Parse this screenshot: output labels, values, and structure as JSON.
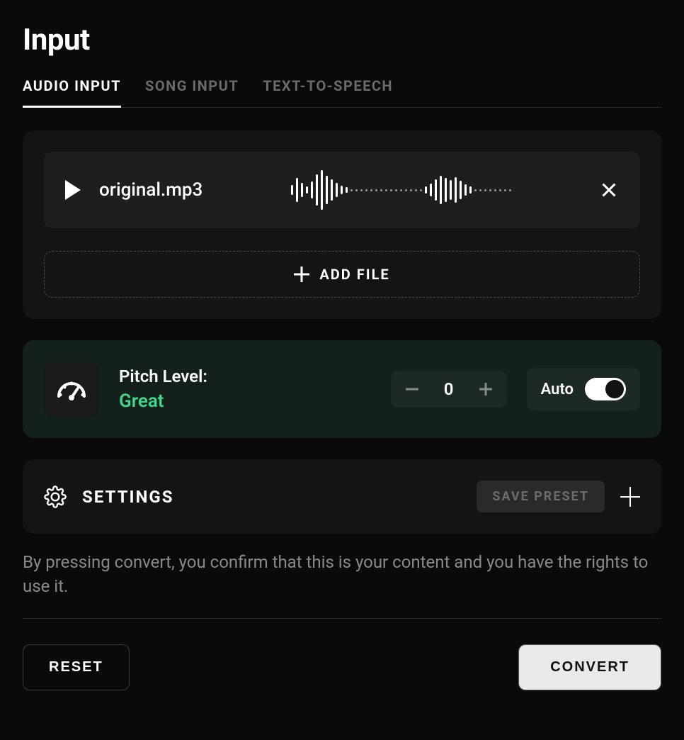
{
  "header": {
    "title": "Input"
  },
  "tabs": [
    {
      "label": "AUDIO INPUT",
      "active": true
    },
    {
      "label": "SONG INPUT",
      "active": false
    },
    {
      "label": "TEXT-TO-SPEECH",
      "active": false
    }
  ],
  "file": {
    "name": "original.mp3"
  },
  "add_file": {
    "label": "ADD FILE"
  },
  "pitch": {
    "label": "Pitch Level:",
    "status": "Great",
    "value": "0",
    "auto_label": "Auto",
    "auto_on": true
  },
  "settings": {
    "title": "SETTINGS",
    "save_preset": "SAVE PRESET"
  },
  "disclaimer": "By pressing convert, you confirm that this is your content and you have the rights to use it.",
  "footer": {
    "reset": "RESET",
    "convert": "CONVERT"
  }
}
